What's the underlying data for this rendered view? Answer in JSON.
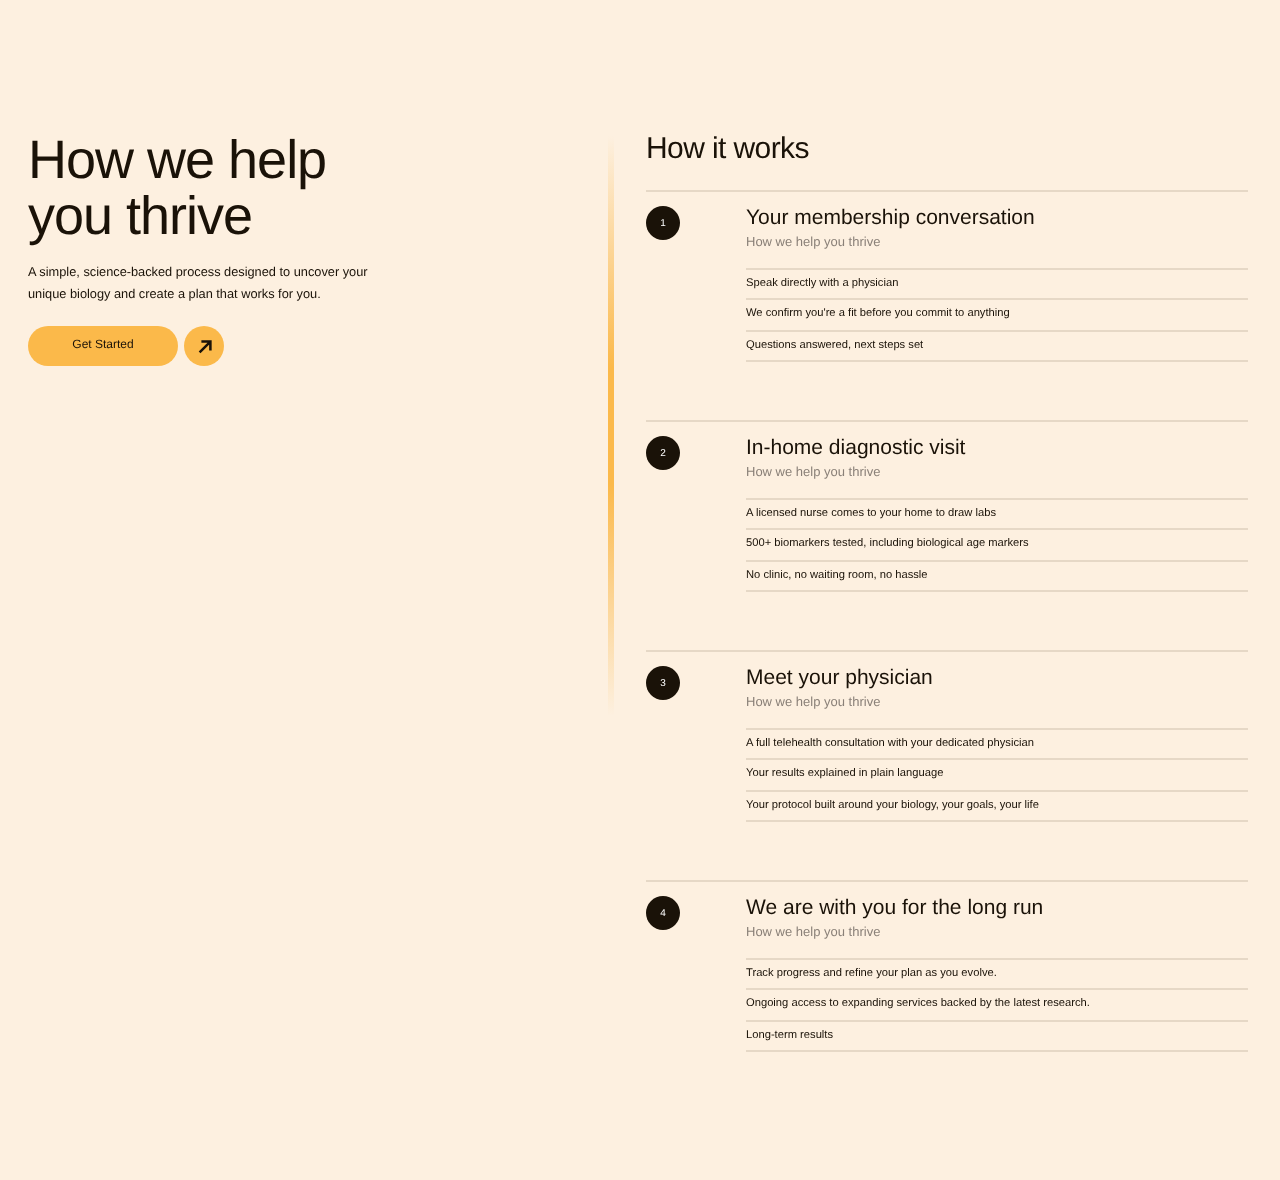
{
  "hero": {
    "title": "How we help you thrive",
    "description": "A simple, science-backed process designed to uncover your unique biology and create a plan that works for you.",
    "cta": "Get Started"
  },
  "how_it_works": {
    "title": "How it works",
    "steps": [
      {
        "number": "1",
        "title": "Your membership conversation",
        "subtitle": "How we help you thrive",
        "points": [
          "Speak directly with a physician",
          "We confirm you're a fit before you commit to anything",
          "Questions answered, next steps set"
        ]
      },
      {
        "number": "2",
        "title": "In-home diagnostic visit",
        "subtitle": "How we help you thrive",
        "points": [
          "A licensed nurse comes to your home to draw labs",
          "500+ biomarkers tested, including biological age markers",
          "No clinic, no waiting room, no hassle"
        ]
      },
      {
        "number": "3",
        "title": "Meet your physician",
        "subtitle": "How we help you thrive",
        "points": [
          "A full telehealth consultation with your dedicated physician",
          "Your results explained in plain language",
          "Your protocol built around your biology, your goals, your life"
        ]
      },
      {
        "number": "4",
        "title": "We are with you for the long run",
        "subtitle": "How we help you thrive",
        "points": [
          "Track progress and refine your plan as you evolve.",
          "Ongoing access to expanding services backed by the latest research.",
          "Long-term results"
        ]
      }
    ]
  }
}
